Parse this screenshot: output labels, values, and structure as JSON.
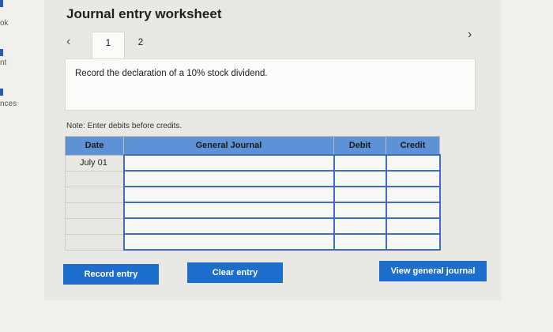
{
  "left_rail": {
    "items": [
      "ok",
      "nt",
      "nces"
    ]
  },
  "header": {
    "title": "Journal entry worksheet"
  },
  "pager": {
    "tabs": [
      "1",
      "2"
    ],
    "active": 0,
    "prev_icon": "‹",
    "next_icon": "›"
  },
  "instruction": "Record the declaration of a 10% stock dividend.",
  "note": "Note: Enter debits before credits.",
  "table": {
    "columns": [
      "Date",
      "General Journal",
      "Debit",
      "Credit"
    ],
    "rows": [
      [
        "July 01",
        "",
        "",
        ""
      ],
      [
        "",
        "",
        "",
        ""
      ],
      [
        "",
        "",
        "",
        ""
      ],
      [
        "",
        "",
        "",
        ""
      ],
      [
        "",
        "",
        "",
        ""
      ],
      [
        "",
        "",
        "",
        ""
      ]
    ]
  },
  "buttons": {
    "record": "Record entry",
    "clear": "Clear entry",
    "view": "View general journal"
  },
  "colors": {
    "accent": "#1e6fcd",
    "table_header": "#5d93d6",
    "input_border": "#3d6ec0"
  }
}
